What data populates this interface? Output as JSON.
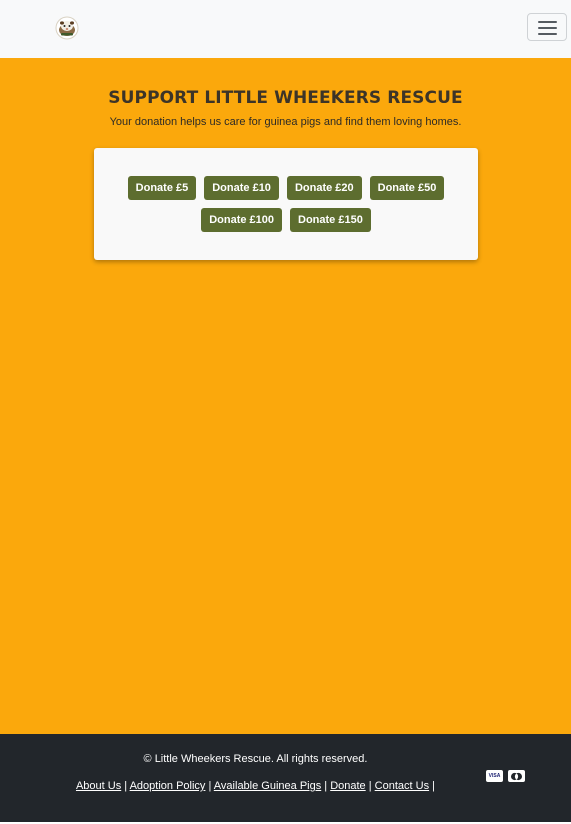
{
  "navbar": {
    "logo_icon": "guinea-pig-logo-icon",
    "toggler_icon": "hamburger-menu-icon"
  },
  "hero": {
    "title": "SUPPORT LITTLE WHEEKERS RESCUE",
    "subtitle": "Your donation helps us care for guinea pigs and find them loving homes."
  },
  "donate": {
    "row1": [
      "Donate £5",
      "Donate £10",
      "Donate £20",
      "Donate £50"
    ],
    "row2": [
      "Donate £100",
      "Donate £150"
    ]
  },
  "footer": {
    "copyright": "© Little Wheekers Rescue. All rights reserved.",
    "links": [
      "About Us",
      "Adoption Policy",
      "Available Guinea Pigs",
      "Donate",
      "Contact Us"
    ],
    "separator": "|",
    "payment_icons": [
      "visa-icon",
      "mastercard-icon"
    ],
    "visa_text": "VISA"
  },
  "colors": {
    "main_bg": "#fba80c",
    "button_bg": "#5d6d2f",
    "footer_bg": "#22262b",
    "navbar_bg": "#f8f9fa"
  }
}
